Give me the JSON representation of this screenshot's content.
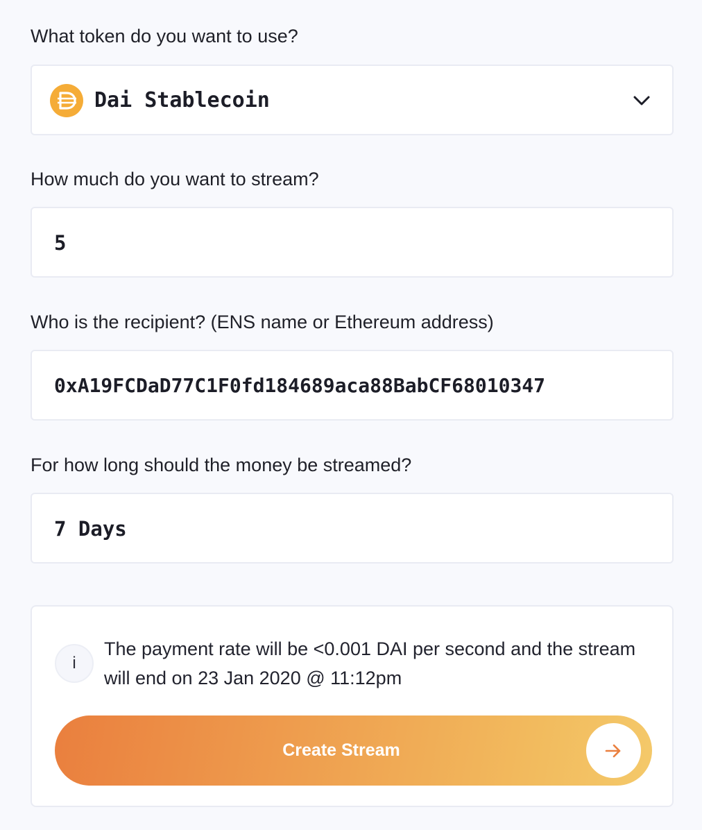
{
  "token": {
    "label": "What token do you want to use?",
    "selected": "Dai Stablecoin",
    "icon": "dai-token-icon",
    "icon_color": "#f5ac37"
  },
  "amount": {
    "label": "How much do you want to stream?",
    "value": "5"
  },
  "recipient": {
    "label": "Who is the recipient? (ENS name or Ethereum address)",
    "value": "0xA19FCDaD77C1F0fd184689aca88BabCF68010347"
  },
  "duration": {
    "label": "For how long should the money be streamed?",
    "value": "7 Days"
  },
  "info": {
    "icon_text": "i",
    "message": "The payment rate will be <0.001 DAI per second and the stream will end on 23 Jan 2020 @ 11:12pm"
  },
  "submit": {
    "label": "Create Stream",
    "icon": "arrow-right-icon",
    "gradient_start": "#ea7f3e",
    "gradient_end": "#f4c96a"
  }
}
